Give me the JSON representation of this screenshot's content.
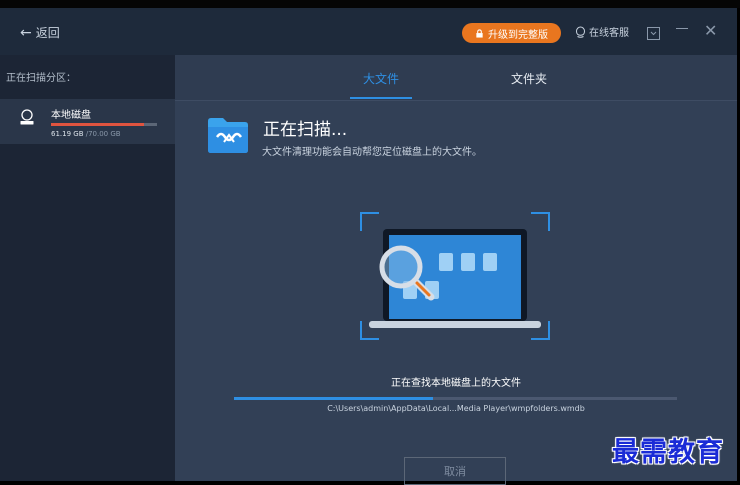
{
  "header": {
    "back_label": "返回",
    "upgrade_label": "升级到完整版",
    "support_label": "在线客服"
  },
  "sidebar": {
    "title": "正在扫描分区：",
    "disk": {
      "name": "本地磁盘",
      "used": "61.19 GB",
      "total": "/70.00 GB",
      "usage_fraction": 0.874
    }
  },
  "tabs": [
    {
      "label": "大文件",
      "active": true
    },
    {
      "label": "文件夹",
      "active": false
    }
  ],
  "scan": {
    "title": "正在扫描...",
    "description": "大文件清理功能会自动帮您定位磁盘上的大文件。",
    "status": "正在查找本地磁盘上的大文件",
    "progress_fraction": 0.45,
    "current_path": "C:\\Users\\admin\\AppData\\Local...Media Player\\wmpfolders.wmdb",
    "cancel_label": "取消"
  },
  "watermark": "最需教育",
  "colors": {
    "accent": "#2e8fe3",
    "upgrade": "#e9761f",
    "disk_usage": "#e0543f"
  }
}
